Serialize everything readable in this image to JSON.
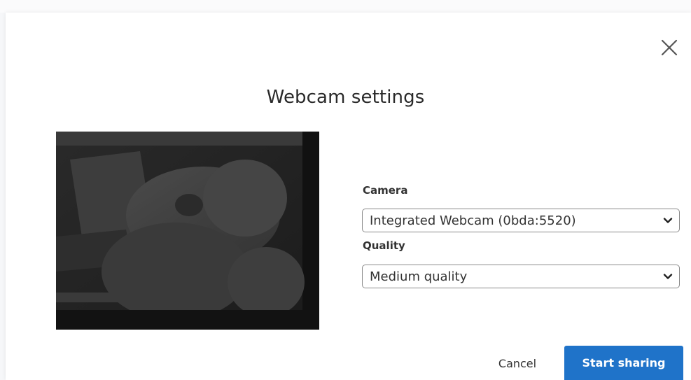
{
  "dialog": {
    "title": "Webcam settings",
    "close_icon": "close-icon"
  },
  "preview": {
    "icon": "webcam-preview-image"
  },
  "camera": {
    "label": "Camera",
    "selected": "Integrated Webcam (0bda:5520)",
    "icon": "chevron-down-icon"
  },
  "quality": {
    "label": "Quality",
    "selected": "Medium quality",
    "icon": "chevron-down-icon"
  },
  "actions": {
    "cancel_label": "Cancel",
    "start_label": "Start sharing"
  },
  "colors": {
    "primary": "#1f73c9",
    "text": "#333333"
  }
}
